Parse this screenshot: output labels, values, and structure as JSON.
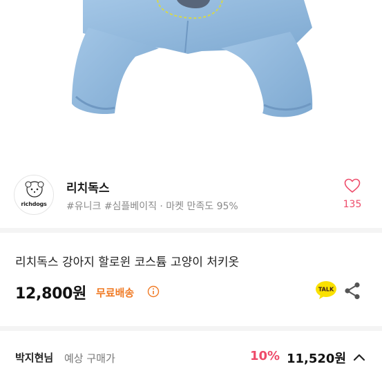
{
  "store": {
    "logo_text": "richdogs",
    "name": "리치독스",
    "tags": "#유니크 #심플베이직 · 마켓 만족도 95%",
    "like_count": "135"
  },
  "product": {
    "title": "리치독스 강아지 할로윈 코스튬 고양이 처키옷",
    "price": "12,800원",
    "shipping": "무료배송",
    "talk_label": "TALK"
  },
  "buyer_price": {
    "name": "박지현님",
    "label": "예상 구매가",
    "discount_rate": "10%",
    "discounted_price": "11,520원"
  },
  "colors": {
    "accent_pink": "#ee4b6a",
    "shipping_orange": "#f07a24",
    "talk_yellow": "#fae100",
    "fabric_blue": "#8fb8dc"
  },
  "icons": [
    "heart-icon",
    "info-icon",
    "talk-icon",
    "share-icon",
    "chevron-up-icon"
  ]
}
